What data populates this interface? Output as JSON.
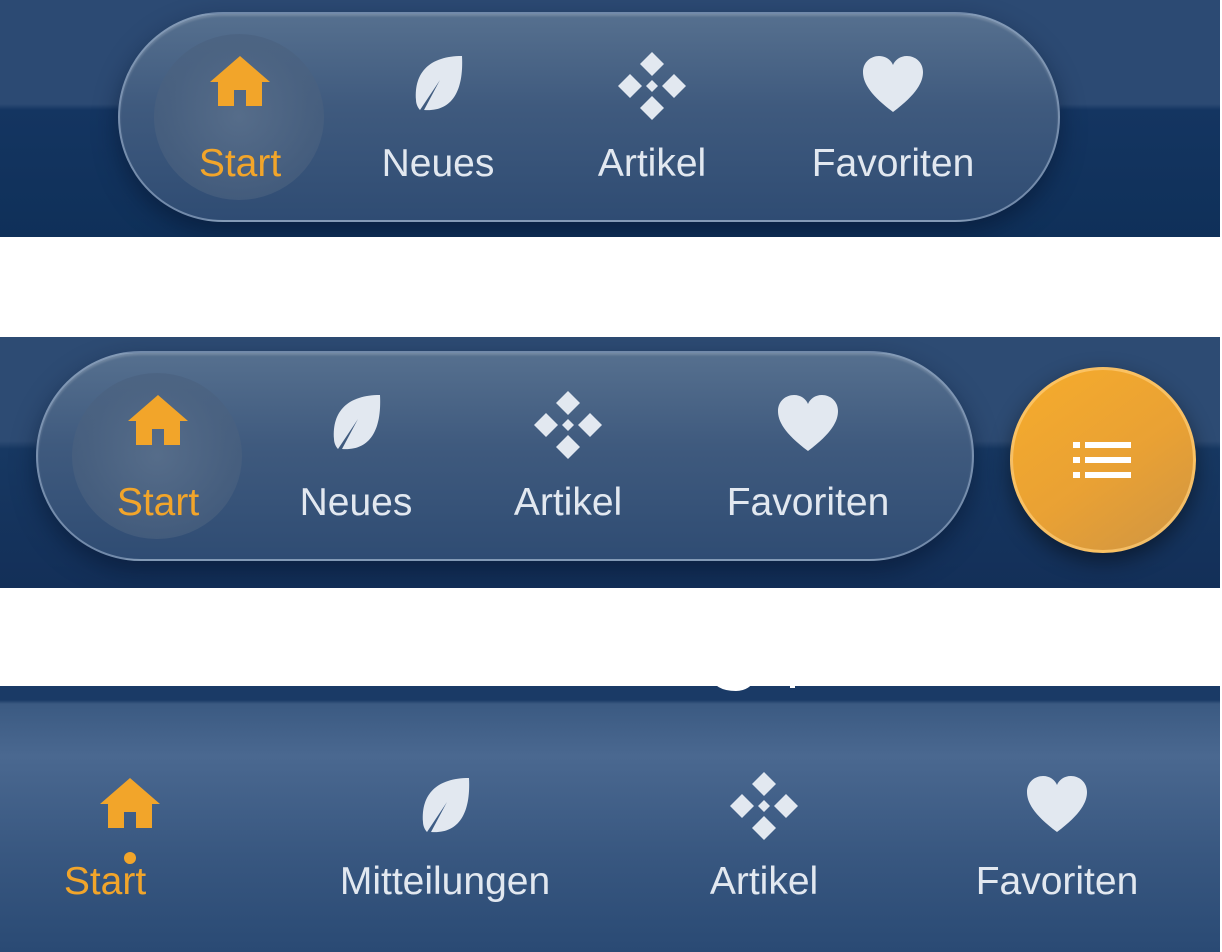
{
  "colors": {
    "active": "#f2a52a",
    "inactive": "#e2e8f0",
    "fab": "#f2a52a"
  },
  "variant_pill": {
    "items": [
      {
        "label": "Start",
        "icon": "home-icon",
        "active": true
      },
      {
        "label": "Neues",
        "icon": "leaf-icon",
        "active": false
      },
      {
        "label": "Artikel",
        "icon": "diamond-grid-icon",
        "active": false
      },
      {
        "label": "Favoriten",
        "icon": "heart-icon",
        "active": false
      }
    ]
  },
  "variant_pill_fab": {
    "items": [
      {
        "label": "Start",
        "icon": "home-icon",
        "active": true
      },
      {
        "label": "Neues",
        "icon": "leaf-icon",
        "active": false
      },
      {
        "label": "Artikel",
        "icon": "diamond-grid-icon",
        "active": false
      },
      {
        "label": "Favoriten",
        "icon": "heart-icon",
        "active": false
      }
    ],
    "fab": {
      "icon": "list-icon"
    }
  },
  "variant_bar": {
    "items": [
      {
        "label": "Start",
        "icon": "home-icon",
        "active": true
      },
      {
        "label": "Mitteilungen",
        "icon": "leaf-icon",
        "active": false
      },
      {
        "label": "Artikel",
        "icon": "diamond-grid-icon",
        "active": false
      },
      {
        "label": "Favoriten",
        "icon": "heart-icon",
        "active": false
      }
    ]
  }
}
